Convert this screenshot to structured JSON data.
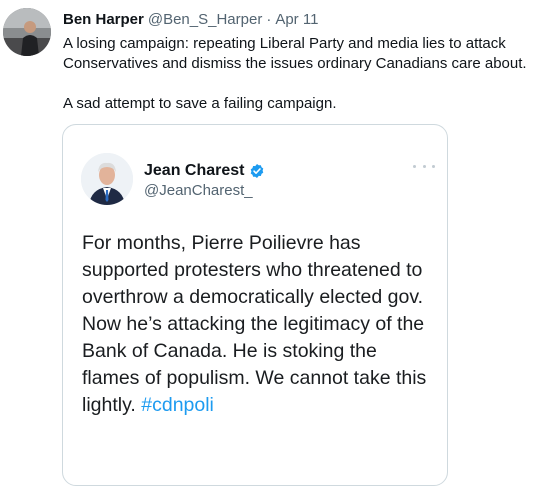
{
  "tweet": {
    "author_name": "Ben Harper",
    "author_handle": "@Ben_S_Harper",
    "separator": "·",
    "date": "Apr 11",
    "text_line1": "A losing campaign: repeating Liberal Party and media lies to attack Conservatives and dismiss the issues ordinary Canadians care about.",
    "text_line2": "A sad attempt to save a failing campaign."
  },
  "quoted_tweet": {
    "author_name": "Jean Charest",
    "author_handle": "@JeanCharest_",
    "verified": true,
    "text": "For months, Pierre Poilievre has supported protesters who threatened to overthrow a democratically elected gov. Now he’s attacking the legitimacy of the Bank of Canada. He is stoking the flames of populism. We cannot take this lightly.",
    "hashtag": "#cdnpoli"
  },
  "colors": {
    "link": "#1d9bf0",
    "secondary_text": "#536471",
    "border": "#cfd9de",
    "verified_badge": "#1d9bf0"
  },
  "icons": {
    "verified": "verified-badge-icon",
    "more": "more-options-icon"
  }
}
